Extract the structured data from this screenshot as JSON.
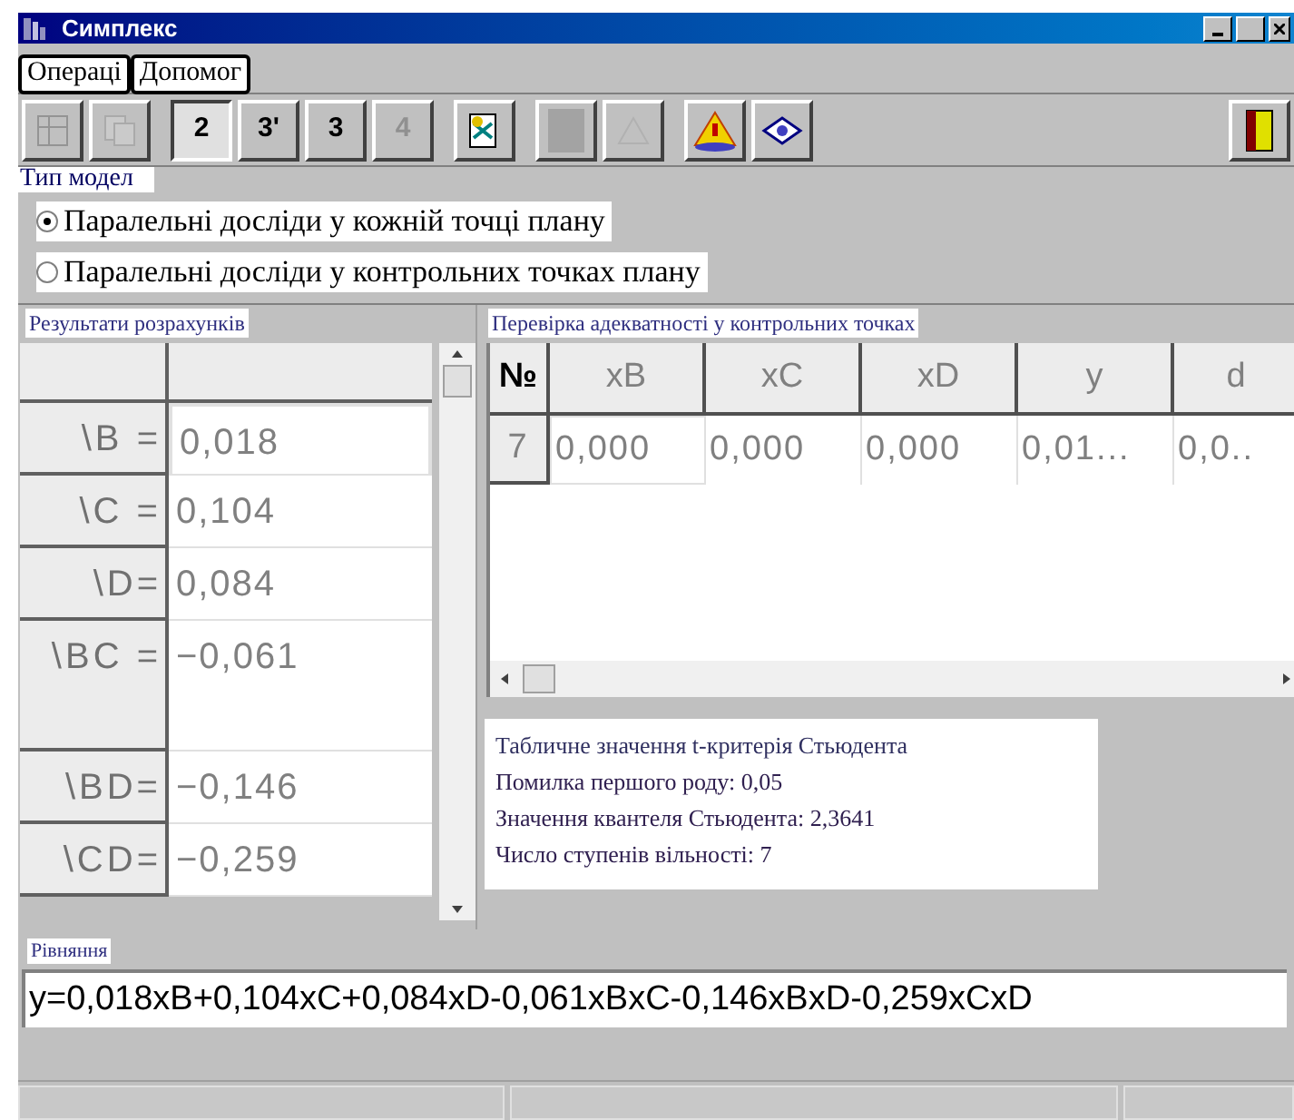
{
  "window": {
    "title": "Симплекс"
  },
  "menu": [
    "Операці",
    "Допомог"
  ],
  "toolbar": [
    {
      "kind": "icon",
      "disabled": true,
      "selected": false
    },
    {
      "kind": "icon",
      "disabled": true,
      "selected": false
    },
    {
      "kind": "text",
      "label": "2",
      "disabled": false,
      "selected": true
    },
    {
      "kind": "text",
      "label": "3'",
      "disabled": false,
      "selected": false
    },
    {
      "kind": "text",
      "label": "3",
      "disabled": false,
      "selected": false
    },
    {
      "kind": "text",
      "label": "4",
      "disabled": true,
      "selected": false
    },
    {
      "kind": "icon",
      "disabled": false,
      "selected": false
    },
    {
      "kind": "icon",
      "disabled": true,
      "selected": false
    },
    {
      "kind": "icon",
      "disabled": true,
      "selected": false
    },
    {
      "kind": "icon",
      "disabled": false,
      "selected": false
    },
    {
      "kind": "icon",
      "disabled": false,
      "selected": false
    }
  ],
  "model_type": {
    "label": "Тип модел",
    "options": [
      {
        "label": "Паралельні досліди у кожній точці плану",
        "selected": true
      },
      {
        "label": "Паралельні досліди у контрольних точках плану",
        "selected": false
      }
    ]
  },
  "results": {
    "title": "Результати розрахунків",
    "rows": [
      {
        "label": "\\B =",
        "value": "0,018",
        "tall": false
      },
      {
        "label": "\\C =",
        "value": "0,104",
        "tall": false
      },
      {
        "label": "\\D=",
        "value": "0,084",
        "tall": false
      },
      {
        "label": "\\BC =",
        "value": "−0,061",
        "tall": true
      },
      {
        "label": "\\BD=",
        "value": "−0,146",
        "tall": false
      },
      {
        "label": "\\CD=",
        "value": "−0,259",
        "tall": false
      }
    ]
  },
  "adequacy": {
    "title": "Перевірка адекватності у контрольних точках",
    "columns": [
      "№",
      "xB",
      "xC",
      "xD",
      "y",
      "d"
    ],
    "rows": [
      [
        "7",
        "0,000",
        "0,000",
        "0,000",
        "0,01...",
        "0,0.."
      ]
    ]
  },
  "student": {
    "title": "Табличне значення t-критерія Стьюдента",
    "lines": [
      "Помилка першого роду:  0,05",
      "Значення квантеля Стьюдента: 2,3641",
      "Число ступенів вільності: 7"
    ]
  },
  "equation": {
    "title": "Рівняння",
    "value": "y=0,018xB+0,104xC+0,084xD-0,061xBxC-0,146xBxD-0,259xCxD"
  }
}
